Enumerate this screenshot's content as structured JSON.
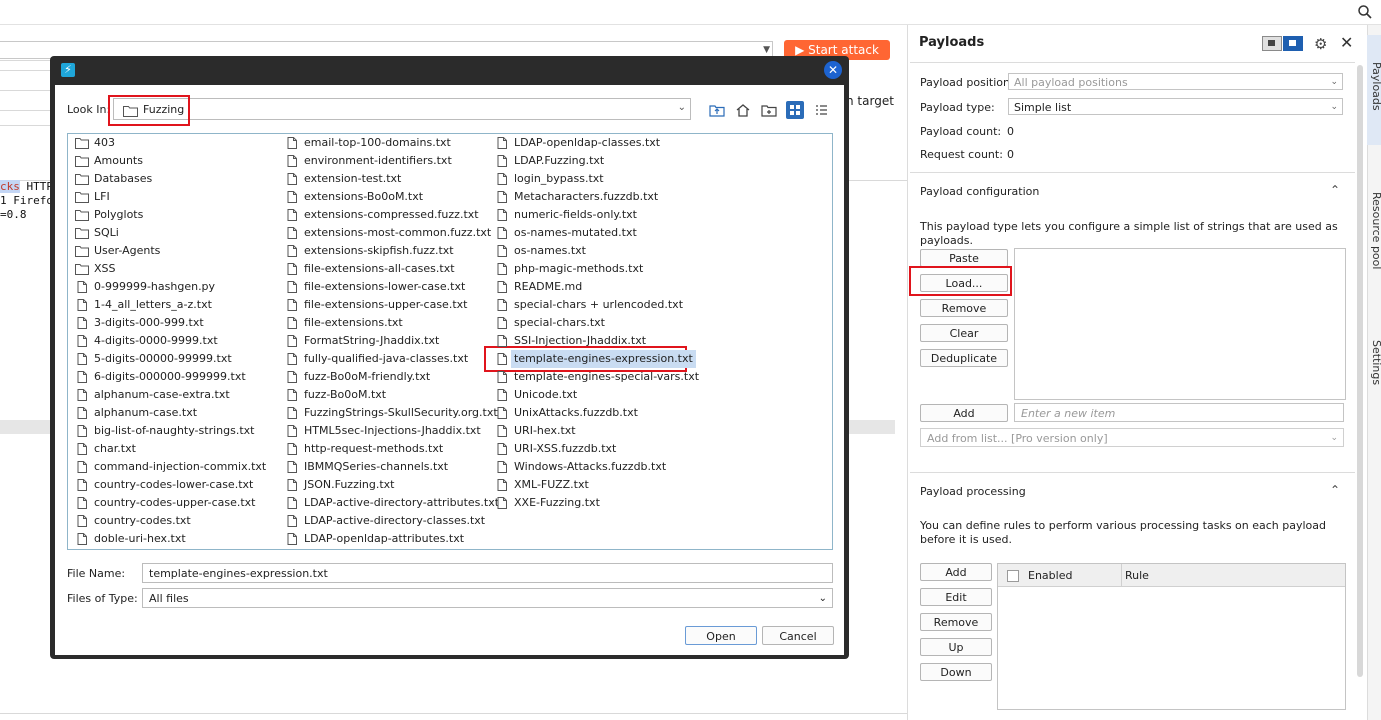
{
  "background": {
    "start_attack_label": "Start attack",
    "target_text": "h target",
    "code_line1_hl": "cks",
    "code_line1_rest": " HTTP",
    "code_line2": "1 Firefo",
    "code_line3": "=0.8"
  },
  "payloads_panel": {
    "title": "Payloads",
    "position_label": "Payload position:",
    "position_value": "All payload positions",
    "type_label": "Payload type:",
    "type_value": "Simple list",
    "count_label": "Payload count:",
    "count_value": "0",
    "request_label": "Request count:",
    "request_value": "0",
    "config_title": "Payload configuration",
    "config_desc": "This payload type lets you configure a simple list of strings that are used as payloads.",
    "buttons": [
      "Paste",
      "Load...",
      "Remove",
      "Clear",
      "Deduplicate"
    ],
    "add_label": "Add",
    "new_item_placeholder": "Enter a new item",
    "add_from_list": "Add from list... [Pro version only]",
    "processing_title": "Payload processing",
    "processing_desc": "You can define rules to perform various processing tasks on each payload before it is used.",
    "processing_buttons": [
      "Add",
      "Edit",
      "Remove",
      "Up",
      "Down"
    ],
    "rules_cols": [
      "Enabled",
      "Rule"
    ]
  },
  "side_tabs": [
    "Payloads",
    "Resource pool",
    "Settings"
  ],
  "dialog": {
    "look_in_label": "Look In:",
    "look_in_value": "Fuzzing",
    "col1": [
      "403",
      "Amounts",
      "Databases",
      "LFI",
      "Polyglots",
      "SQLi",
      "User-Agents",
      "XSS",
      "0-999999-hashgen.py",
      "1-4_all_letters_a-z.txt",
      "3-digits-000-999.txt",
      "4-digits-0000-9999.txt",
      "5-digits-00000-99999.txt",
      "6-digits-000000-999999.txt",
      "alphanum-case-extra.txt",
      "alphanum-case.txt",
      "big-list-of-naughty-strings.txt",
      "char.txt",
      "command-injection-commix.txt",
      "country-codes-lower-case.txt",
      "country-codes-upper-case.txt",
      "country-codes.txt",
      "doble-uri-hex.txt"
    ],
    "col2": [
      "email-top-100-domains.txt",
      "environment-identifiers.txt",
      "extension-test.txt",
      "extensions-Bo0oM.txt",
      "extensions-compressed.fuzz.txt",
      "extensions-most-common.fuzz.txt",
      "extensions-skipfish.fuzz.txt",
      "file-extensions-all-cases.txt",
      "file-extensions-lower-case.txt",
      "file-extensions-upper-case.txt",
      "file-extensions.txt",
      "FormatString-Jhaddix.txt",
      "fully-qualified-java-classes.txt",
      "fuzz-Bo0oM-friendly.txt",
      "fuzz-Bo0oM.txt",
      "FuzzingStrings-SkullSecurity.org.txt",
      "HTML5sec-Injections-Jhaddix.txt",
      "http-request-methods.txt",
      "IBMMQSeries-channels.txt",
      "JSON.Fuzzing.txt",
      "LDAP-active-directory-attributes.txt",
      "LDAP-active-directory-classes.txt",
      "LDAP-openldap-attributes.txt"
    ],
    "col3": [
      "LDAP-openldap-classes.txt",
      "LDAP.Fuzzing.txt",
      "login_bypass.txt",
      "Metacharacters.fuzzdb.txt",
      "numeric-fields-only.txt",
      "os-names-mutated.txt",
      "os-names.txt",
      "php-magic-methods.txt",
      "README.md",
      "special-chars + urlencoded.txt",
      "special-chars.txt",
      "SSI-Injection-Jhaddix.txt",
      "template-engines-expression.txt",
      "template-engines-special-vars.txt",
      "Unicode.txt",
      "UnixAttacks.fuzzdb.txt",
      "URI-hex.txt",
      "URI-XSS.fuzzdb.txt",
      "Windows-Attacks.fuzzdb.txt",
      "XML-FUZZ.txt",
      "XXE-Fuzzing.txt"
    ],
    "folder_count": 8,
    "selected_file": "template-engines-expression.txt",
    "file_name_label": "File Name:",
    "file_name_value": "template-engines-expression.txt",
    "file_type_label": "Files of Type:",
    "file_type_value": "All files",
    "open_label": "Open",
    "cancel_label": "Cancel"
  },
  "colors": {
    "accent_orange": "#ff6633",
    "highlight_red": "#e0141c",
    "selection_blue": "#c9dcf2",
    "dialog_frame": "#2b2b2b"
  }
}
